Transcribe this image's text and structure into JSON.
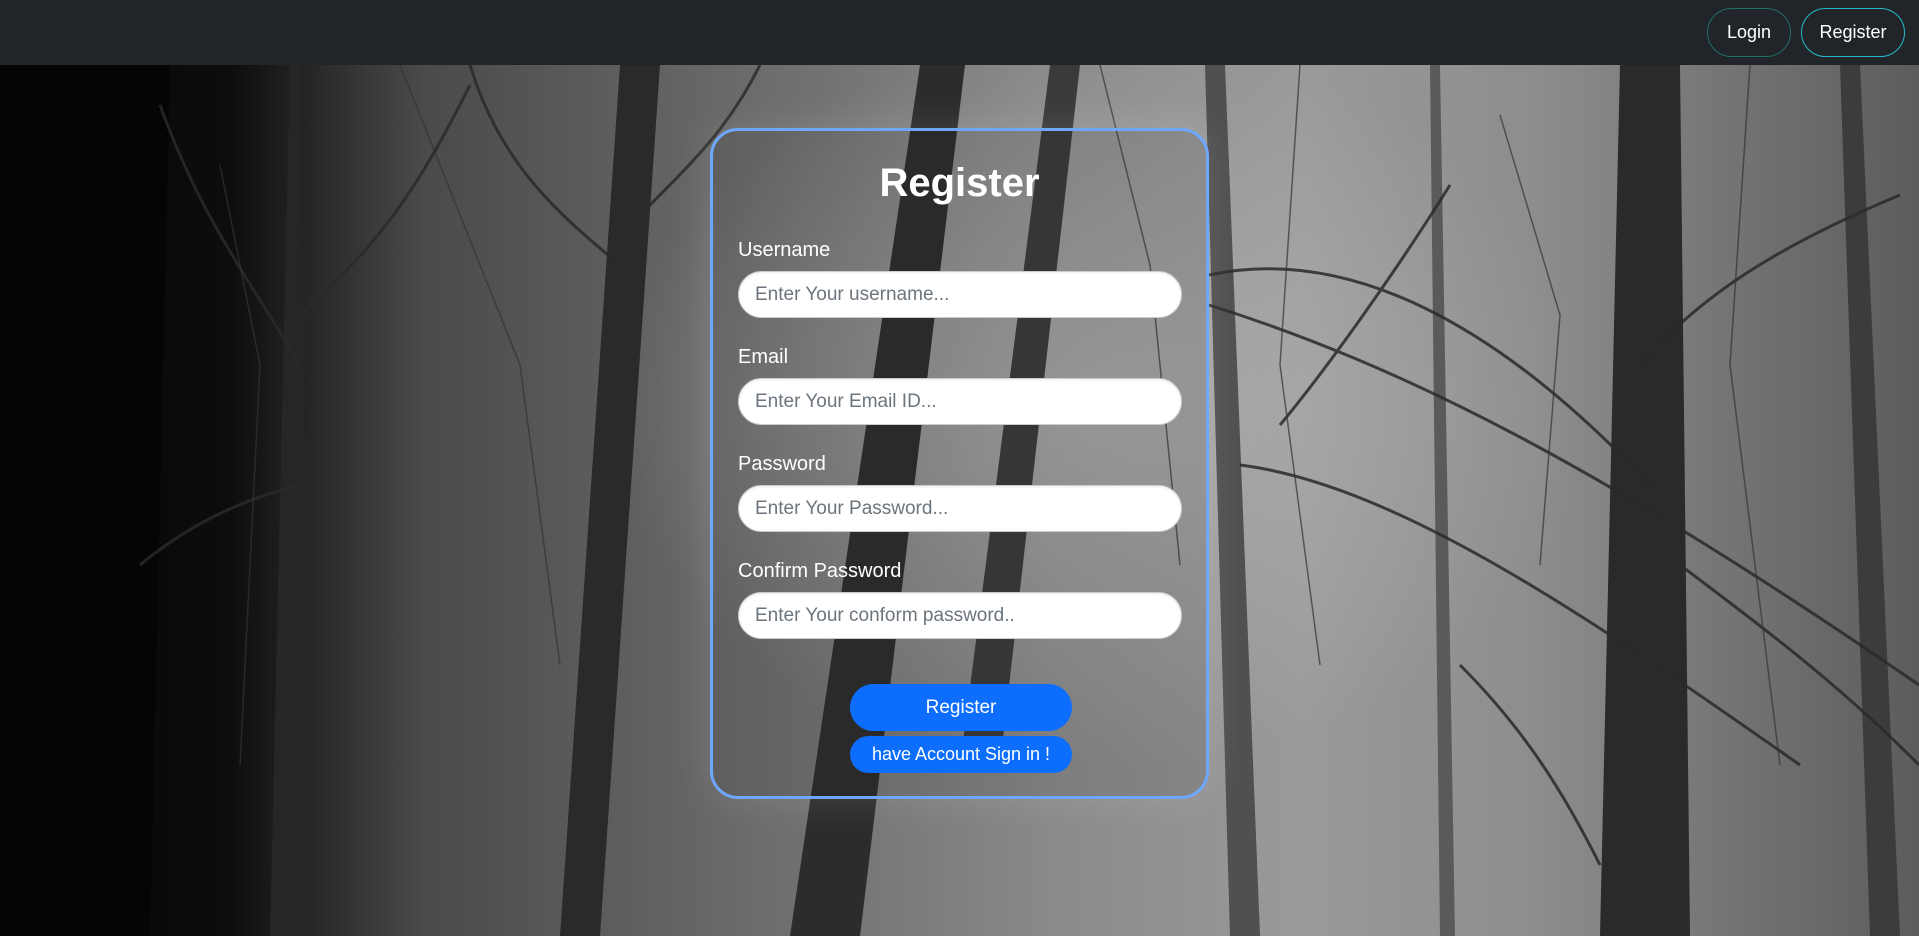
{
  "navbar": {
    "login_label": "Login",
    "register_label": "Register"
  },
  "form": {
    "title": "Register",
    "username": {
      "label": "Username",
      "placeholder": "Enter Your username..."
    },
    "email": {
      "label": "Email",
      "placeholder": "Enter Your Email ID..."
    },
    "password": {
      "label": "Password",
      "placeholder": "Enter Your Password..."
    },
    "confirm_password": {
      "label": "Confirm Password",
      "placeholder": "Enter Your conform password.."
    },
    "register_button": "Register",
    "signin_button": "have Account Sign in !"
  },
  "colors": {
    "navbar_bg": "#212529",
    "card_border": "#6ea8fe",
    "primary_button": "#0d6efd"
  }
}
